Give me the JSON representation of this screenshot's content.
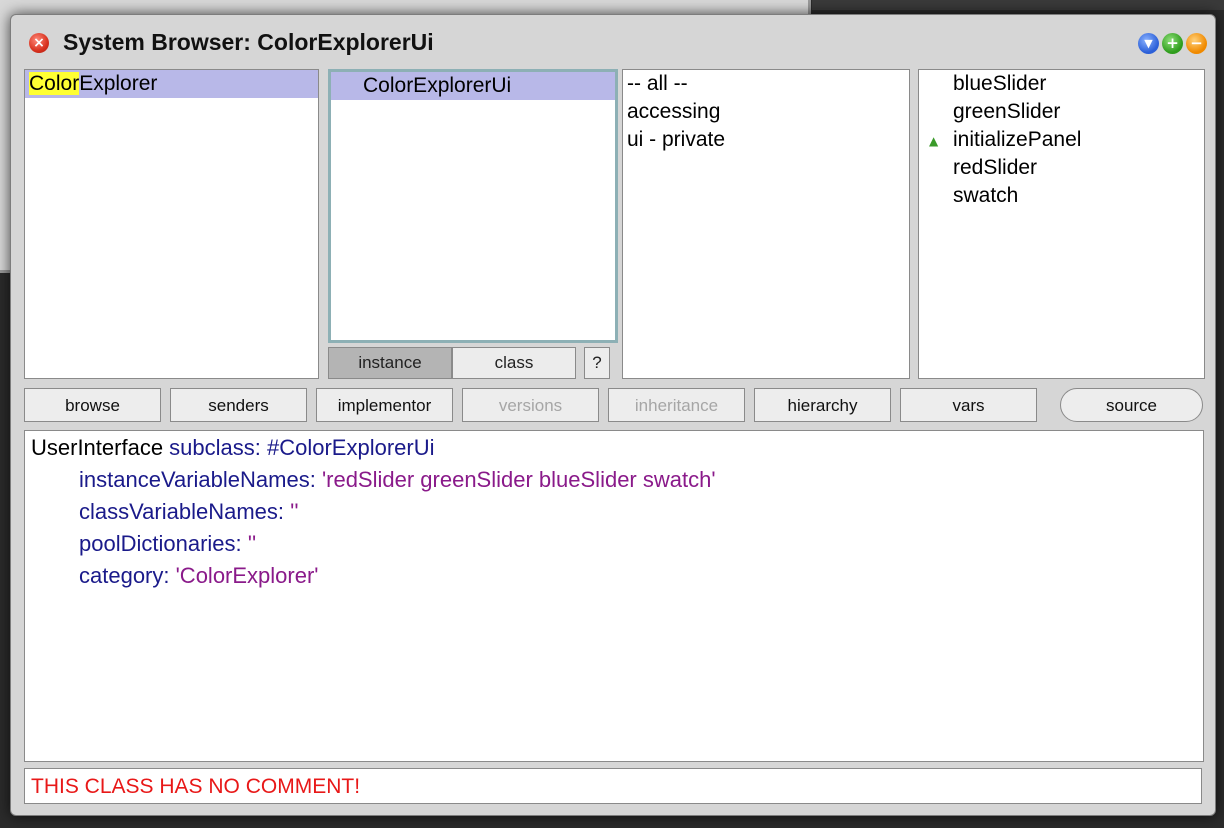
{
  "window": {
    "title": "System Browser: ColorExplorerUi"
  },
  "packages": {
    "selected_highlight": "Color",
    "selected_rest": "Explorer"
  },
  "classes": {
    "items": [
      "ColorExplorerUi"
    ]
  },
  "class_side": {
    "instance_label": "instance",
    "class_label": "class",
    "help_label": "?"
  },
  "protocols": {
    "items": [
      "-- all --",
      "accessing",
      "ui - private"
    ]
  },
  "methods": {
    "items": [
      "blueSlider",
      "greenSlider",
      "initializePanel",
      "redSlider",
      "swatch"
    ]
  },
  "toolbar": {
    "browse": "browse",
    "senders": "senders",
    "implementor": "implementor",
    "versions": "versions",
    "inheritance": "inheritance",
    "hierarchy": "hierarchy",
    "vars": "vars",
    "source": "source"
  },
  "code": {
    "line1_a": "UserInterface",
    "line1_b": " subclass: #ColorExplorerUi",
    "line2_a": "instanceVariableNames: ",
    "line2_b": "'redSlider greenSlider blueSlider swatch'",
    "line3_a": "classVariableNames: ",
    "line3_b": "''",
    "line4_a": "poolDictionaries: ",
    "line4_b": "''",
    "line5_a": "category: ",
    "line5_b": "'ColorExplorer'"
  },
  "comment": {
    "text": "THIS CLASS HAS NO COMMENT!"
  },
  "colors": {
    "selection": "#b8b8e8",
    "highlight": "#ffff33",
    "keyword": "#1a1a8a",
    "string": "#8a1a8a",
    "comment_text": "#e81818"
  }
}
